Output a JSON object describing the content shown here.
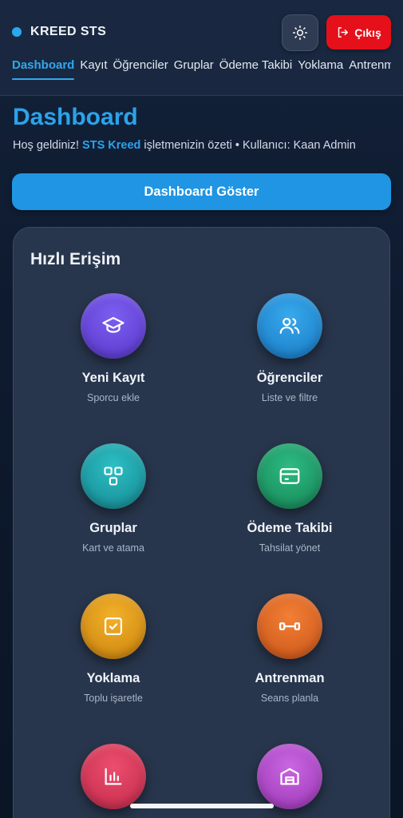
{
  "header": {
    "brand": "KREED STS",
    "logout_label": "Çıkış",
    "nav": [
      "Dashboard",
      "Kayıt",
      "Öğrenciler",
      "Gruplar",
      "Ödeme Takibi",
      "Yoklama",
      "Antrenman"
    ]
  },
  "main": {
    "title": "Dashboard",
    "subtitle_prefix": "Hoş geldiniz! ",
    "subtitle_company": "STS Kreed",
    "subtitle_suffix": " işletmenizin özeti • Kullanıcı: Kaan Admin",
    "primary_button": "Dashboard Göster"
  },
  "quick_access": {
    "title": "Hızlı Erişim",
    "tiles": [
      {
        "title": "Yeni Kayıt",
        "subtitle": "Sporcu ekle",
        "icon": "graduation-cap-icon",
        "color": "#6a4bd8"
      },
      {
        "title": "Öğrenciler",
        "subtitle": "Liste ve filtre",
        "icon": "users-icon",
        "color": "#2196dc"
      },
      {
        "title": "Gruplar",
        "subtitle": "Kart ve atama",
        "icon": "grid-icon",
        "color": "#1ba5ad"
      },
      {
        "title": "Ödeme Takibi",
        "subtitle": "Tahsilat yönet",
        "icon": "credit-card-icon",
        "color": "#1fa26e"
      },
      {
        "title": "Yoklama",
        "subtitle": "Toplu işaretle",
        "icon": "checkbox-icon",
        "color": "#e09a14"
      },
      {
        "title": "Antrenman",
        "subtitle": "Seans planla",
        "icon": "dumbbell-icon",
        "color": "#e66a22"
      },
      {
        "title": "",
        "subtitle": "",
        "icon": "bar-chart-icon",
        "color": "#dc3a5c"
      },
      {
        "title": "",
        "subtitle": "",
        "icon": "warehouse-icon",
        "color": "#b84fd0"
      }
    ]
  },
  "colors": {
    "accent": "#2ba3ec",
    "danger": "#e5101a",
    "card_bg": "#28364d"
  }
}
